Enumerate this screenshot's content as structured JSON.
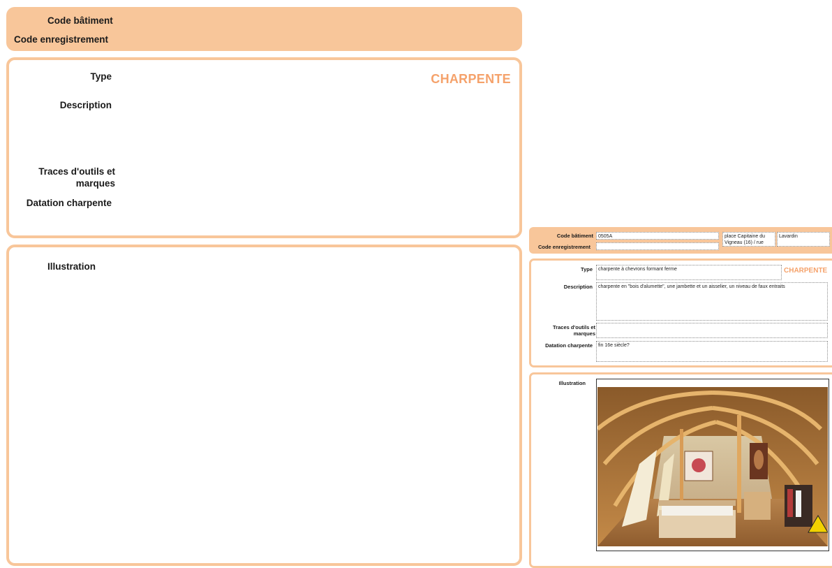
{
  "template_form": {
    "header": {
      "code_batiment_label": "Code bâtiment",
      "code_enregistrement_label": "Code enregistrement"
    },
    "details": {
      "type_label": "Type",
      "category_title": "CHARPENTE",
      "description_label": "Description",
      "traces_label_line1": "Traces d'outils et",
      "traces_label_line2": "marques",
      "datation_label": "Datation charpente"
    },
    "illustration": {
      "label": "Illustration"
    }
  },
  "filled_form": {
    "header": {
      "code_batiment_label": "Code bâtiment",
      "code_batiment_value": "0505A",
      "address_value": "place Capitaine du Vigneau (16) / rue",
      "commune_value": "Lavardin",
      "code_enregistrement_label": "Code enregistrement",
      "code_enregistrement_value": ""
    },
    "details": {
      "type_label": "Type",
      "type_value": "charpente à chevrons formant ferme",
      "category_title": "CHARPENTE",
      "description_label": "Description",
      "description_value": "charpente en \"bois d'alumette\", une jambette et un aisselier, un niveau de faux entraits",
      "traces_label_line1": "Traces d'outils et",
      "traces_label_line2": "marques",
      "traces_value": "",
      "datation_label": "Datation charpente",
      "datation_value": "fin 16e siècle?"
    },
    "illustration": {
      "label": "Illustration",
      "image_icon": "attic-bedroom-photo"
    }
  },
  "colors": {
    "accent_fill": "#f8c69a",
    "accent_text": "#f5a26b"
  }
}
